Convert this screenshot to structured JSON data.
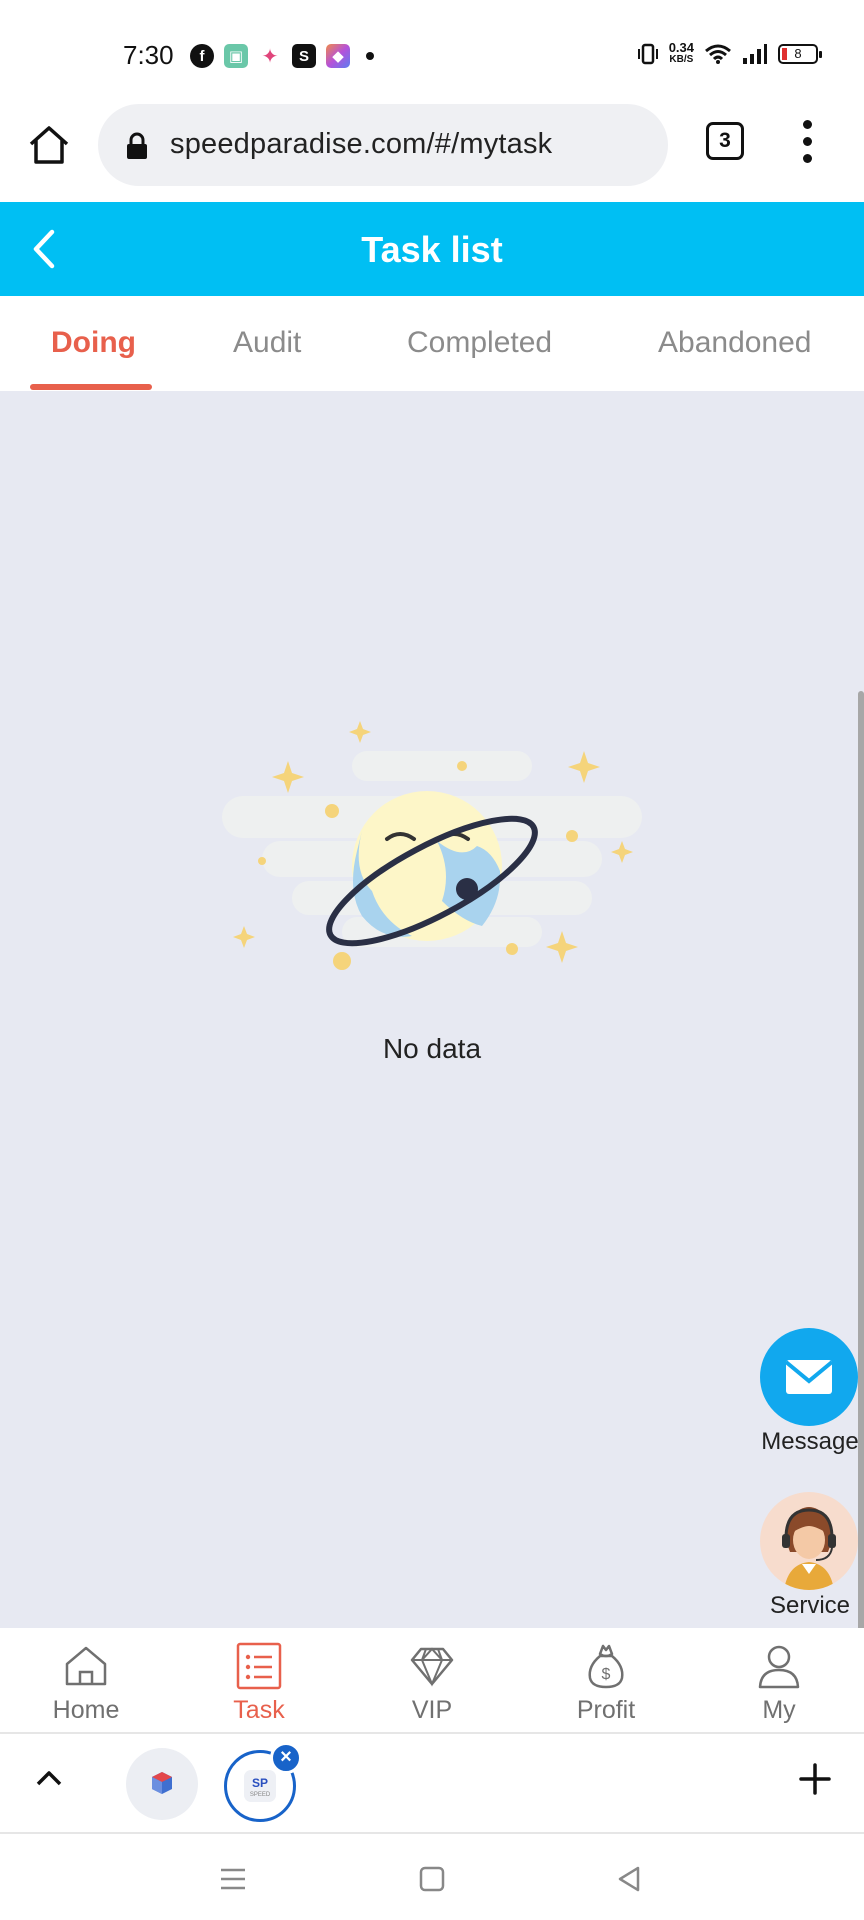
{
  "status_bar": {
    "time": "7:30",
    "net_speed_value": "0.34",
    "net_speed_unit": "KB/S",
    "battery_level": "8",
    "icons": [
      "facebook-icon",
      "app-icon",
      "star-icon",
      "shopping-bag-icon",
      "gallery-icon",
      "vibrate-icon",
      "wifi-icon",
      "signal-icon",
      "battery-icon"
    ]
  },
  "browser": {
    "url": "speedparadise.com/#/mytask",
    "tab_count": "3"
  },
  "header": {
    "title": "Task list",
    "accent_color": "#00bff3"
  },
  "tabs": [
    {
      "label": "Doing",
      "active": true
    },
    {
      "label": "Audit",
      "active": false
    },
    {
      "label": "Completed",
      "active": false
    },
    {
      "label": "Abandoned",
      "active": false
    }
  ],
  "active_color": "#e8604c",
  "empty_state": {
    "text": "No data"
  },
  "floating": {
    "message_label": "Message",
    "service_label": "Service"
  },
  "bottom_nav": [
    {
      "label": "Home",
      "icon": "home-icon",
      "active": false
    },
    {
      "label": "Task",
      "icon": "task-list-icon",
      "active": true
    },
    {
      "label": "VIP",
      "icon": "diamond-icon",
      "active": false
    },
    {
      "label": "Profit",
      "icon": "money-bag-icon",
      "active": false
    },
    {
      "label": "My",
      "icon": "user-icon",
      "active": false
    }
  ]
}
